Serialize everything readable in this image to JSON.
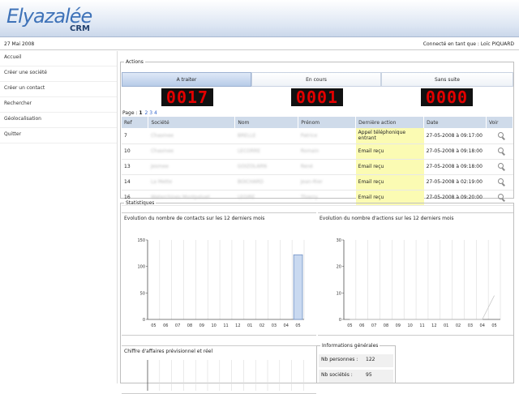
{
  "header": {
    "logo": "Elyazalée",
    "logo_sub": "CRM"
  },
  "infobar": {
    "date": "27 Mai 2008",
    "user": "Connecté en tant que : Loïc PIQUARD"
  },
  "sidebar": {
    "items": [
      {
        "label": "Accueil"
      },
      {
        "label": "Créer une société"
      },
      {
        "label": "Créer un contact"
      },
      {
        "label": "Rechercher"
      },
      {
        "label": "Géolocalisation"
      },
      {
        "label": "Quitter"
      }
    ]
  },
  "actions": {
    "legend": "Actions",
    "tabs": [
      {
        "label": "A traiter",
        "count": "0017"
      },
      {
        "label": "En cours",
        "count": "0001"
      },
      {
        "label": "Sans suite",
        "count": "0000"
      }
    ],
    "pager": {
      "label": "Page :",
      "current": "1",
      "others": "2 3 4"
    },
    "columns": [
      "Ref",
      "Société",
      "Nom",
      "Prénom",
      "Dernière action",
      "Date",
      "Voir"
    ],
    "rows": [
      {
        "ref": "7",
        "societe": "Chasmee",
        "nom": "BRELLE",
        "prenom": "Patrice",
        "action": "Appel téléphonique entrant",
        "date": "27-05-2008 à 09:17:00"
      },
      {
        "ref": "10",
        "societe": "Chasmee",
        "nom": "LECORRE",
        "prenom": "Romain",
        "action": "Email reçu",
        "date": "27-05-2008 à 09:18:00"
      },
      {
        "ref": "13",
        "societe": "Jesmee",
        "nom": "GOIZOLARN",
        "prenom": "René",
        "action": "Email reçu",
        "date": "27-05-2008 à 09:18:00"
      },
      {
        "ref": "14",
        "societe": "La Mette",
        "nom": "BOICHARD",
        "prenom": "Jean-Rier",
        "action": "Email reçu",
        "date": "27-05-2008 à 02:19:00"
      },
      {
        "ref": "16",
        "societe": "Waterchines Montpaluet",
        "nom": "LEGIRE",
        "prenom": "Thierry",
        "action": "Email reçu",
        "date": "27-05-2008 à 09:20:00"
      }
    ]
  },
  "stats": {
    "legend": "Statistiques",
    "chart1_title": "Evolution du nombre de contacts sur les 12 derniers mois",
    "chart2_title": "Evolution du nombre d'actions sur les 12 derniers mois",
    "chart3_title": "Chiffre d'affaires prévisionnel et réel"
  },
  "infos": {
    "legend": "Informations générales",
    "rows": [
      {
        "label": "Nb personnes :",
        "value": "122"
      },
      {
        "label": "Nb sociétés :",
        "value": "95"
      }
    ]
  },
  "chart_data": [
    {
      "type": "bar",
      "title": "Evolution du nombre de contacts sur les 12 derniers mois",
      "categories": [
        "05",
        "06",
        "07",
        "08",
        "09",
        "10",
        "11",
        "12",
        "01",
        "02",
        "03",
        "04",
        "05"
      ],
      "values": [
        0,
        0,
        0,
        0,
        0,
        0,
        0,
        0,
        0,
        0,
        0,
        0,
        122
      ],
      "yticks": [
        "0",
        "50",
        "100",
        "150"
      ],
      "ylim": [
        0,
        150
      ]
    },
    {
      "type": "line",
      "title": "Evolution du nombre d'actions sur les 12 derniers mois",
      "categories": [
        "05",
        "06",
        "07",
        "08",
        "09",
        "10",
        "11",
        "12",
        "01",
        "02",
        "03",
        "04",
        "05"
      ],
      "values": [
        0,
        0,
        0,
        0,
        0,
        0,
        0,
        0,
        0,
        0,
        0,
        0,
        9
      ],
      "yticks": [
        "0",
        "10",
        "20",
        "30"
      ],
      "ylim": [
        0,
        30
      ]
    }
  ]
}
